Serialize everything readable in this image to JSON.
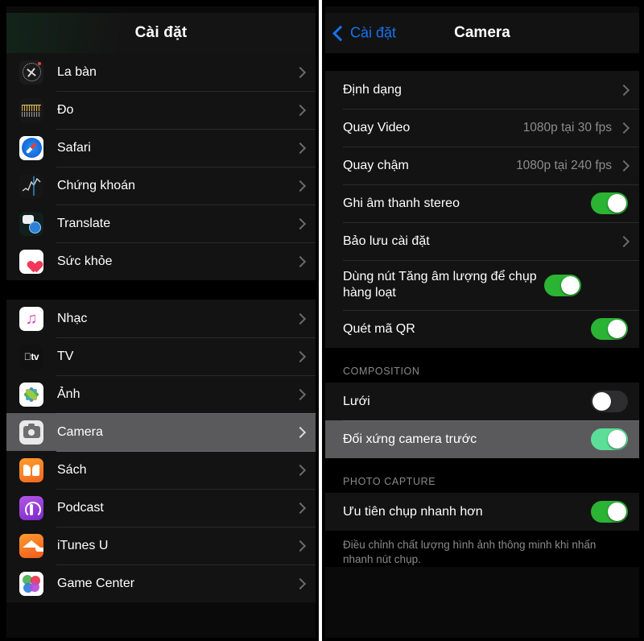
{
  "left_screen": {
    "nav": {
      "title": "Cài đặt"
    },
    "groups": [
      {
        "id": "apps-group-1",
        "items": [
          {
            "label": "La bàn",
            "icon": "compass-icon",
            "accessory": "chevron"
          },
          {
            "label": "Đo",
            "icon": "measure-icon",
            "accessory": "chevron"
          },
          {
            "label": "Safari",
            "icon": "safari-icon",
            "accessory": "chevron"
          },
          {
            "label": "Chứng khoán",
            "icon": "stocks-icon",
            "accessory": "chevron"
          },
          {
            "label": "Translate",
            "icon": "translate-icon",
            "accessory": "chevron"
          },
          {
            "label": "Sức khỏe",
            "icon": "health-icon",
            "accessory": "chevron"
          }
        ]
      },
      {
        "id": "apps-group-2",
        "items": [
          {
            "label": "Nhạc",
            "icon": "music-icon",
            "accessory": "chevron",
            "selected": false
          },
          {
            "label": "TV",
            "icon": "tv-icon",
            "accessory": "chevron",
            "selected": false
          },
          {
            "label": "Ảnh",
            "icon": "photos-icon",
            "accessory": "chevron",
            "selected": false
          },
          {
            "label": "Camera",
            "icon": "camera-icon",
            "accessory": "chevron",
            "selected": true
          },
          {
            "label": "Sách",
            "icon": "books-icon",
            "accessory": "chevron",
            "selected": false
          },
          {
            "label": "Podcast",
            "icon": "podcast-icon",
            "accessory": "chevron",
            "selected": false
          },
          {
            "label": "iTunes U",
            "icon": "itunes-u-icon",
            "accessory": "chevron",
            "selected": false
          },
          {
            "label": "Game Center",
            "icon": "game-center-icon",
            "accessory": "chevron",
            "selected": false
          }
        ]
      }
    ]
  },
  "right_screen": {
    "nav": {
      "back_label": "Cài đặt",
      "title": "Camera"
    },
    "sections": [
      {
        "header": "",
        "rows": [
          {
            "label": "Định dạng",
            "value": "",
            "type": "link"
          },
          {
            "label": "Quay Video",
            "value": "1080p tại 30 fps",
            "type": "link"
          },
          {
            "label": "Quay chậm",
            "value": "1080p tại 240 fps",
            "type": "link"
          },
          {
            "label": "Ghi âm thanh stereo",
            "value": "",
            "type": "toggle",
            "on": true
          },
          {
            "label": "Bảo lưu cài đặt",
            "value": "",
            "type": "link"
          },
          {
            "label": "Dùng nút Tăng âm lượng để chụp hàng loạt",
            "value": "",
            "type": "toggle",
            "on": true
          },
          {
            "label": "Quét mã QR",
            "value": "",
            "type": "toggle",
            "on": true
          }
        ]
      },
      {
        "header": "COMPOSITION",
        "rows": [
          {
            "label": "Lưới",
            "value": "",
            "type": "toggle",
            "on": false,
            "selected": false
          },
          {
            "label": "Đối xứng camera trước",
            "value": "",
            "type": "toggle",
            "on": true,
            "selected": true
          }
        ]
      },
      {
        "header": "PHOTO CAPTURE",
        "rows": [
          {
            "label": "Ưu tiên chụp nhanh hơn",
            "value": "",
            "type": "toggle",
            "on": true
          }
        ],
        "footer": "Điều chỉnh chất lượng hình ảnh thông minh khi nhấn nhanh nút chụp."
      }
    ]
  },
  "colors": {
    "accent_blue": "#1773ef",
    "toggle_on": "#2bb334",
    "toggle_on_light": "#5bdf98",
    "toggle_off": "#2e2e30",
    "row_bg": "#131313",
    "row_selected_bg": "#5a5a5c",
    "screen_bg": "#000000",
    "label_text": "#ffffff",
    "value_text": "#8c8c8c"
  }
}
